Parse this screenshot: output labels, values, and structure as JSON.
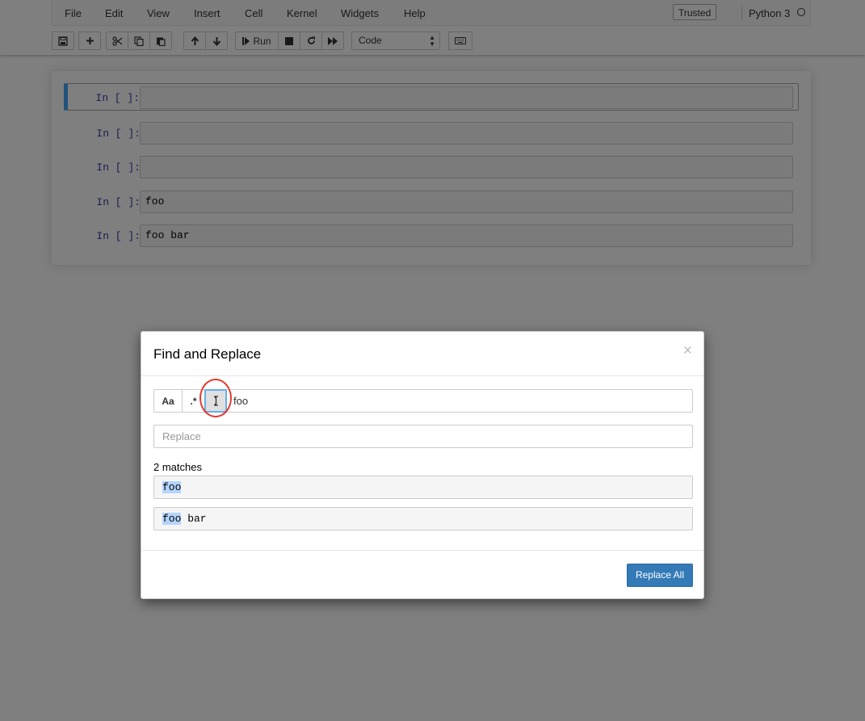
{
  "menubar": {
    "items": [
      "File",
      "Edit",
      "View",
      "Insert",
      "Cell",
      "Kernel",
      "Widgets",
      "Help"
    ],
    "trusted_label": "Trusted",
    "kernel_name": "Python 3"
  },
  "toolbar": {
    "run_label": "Run",
    "cell_type": "Code",
    "icons": [
      "save-icon",
      "plus-icon",
      "scissors-icon",
      "copy-icon",
      "paste-icon",
      "arrow-up-icon",
      "arrow-down-icon",
      "step-forward-icon",
      "stop-icon",
      "refresh-icon",
      "fast-forward-icon",
      "keyboard-icon"
    ]
  },
  "cells": [
    {
      "prompt": "In [ ]:",
      "content": ""
    },
    {
      "prompt": "In [ ]:",
      "content": ""
    },
    {
      "prompt": "In [ ]:",
      "content": ""
    },
    {
      "prompt": "In [ ]:",
      "content": "foo"
    },
    {
      "prompt": "In [ ]:",
      "content": "foo bar"
    }
  ],
  "modal": {
    "title": "Find and Replace",
    "close_glyph": "×",
    "case_label": "Aa",
    "regex_label": ".*",
    "search_value": "foo",
    "replace_placeholder": "Replace",
    "match_count": "2 matches",
    "matches": [
      {
        "highlight": "foo",
        "rest": ""
      },
      {
        "highlight": "foo",
        "rest": " bar"
      }
    ],
    "replace_all_label": "Replace All",
    "accent_color": "#337ab7",
    "annotation_color": "#e33b2e"
  }
}
